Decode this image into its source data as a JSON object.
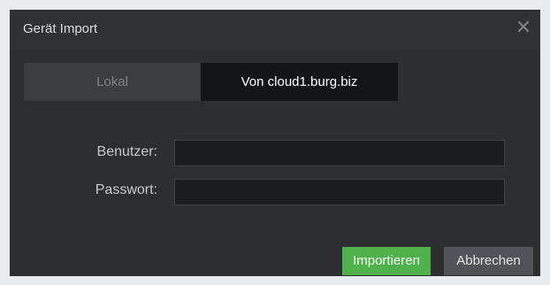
{
  "dialog": {
    "title": "Gerät Import",
    "close_icon": "close-icon"
  },
  "tabs": [
    {
      "label": "Lokal",
      "active": false
    },
    {
      "label": "Von cloud1.burg.biz",
      "active": true
    }
  ],
  "form": {
    "user_label": "Benutzer:",
    "user_value": "",
    "password_label": "Passwort:",
    "password_value": ""
  },
  "buttons": {
    "import_label": "Importieren",
    "cancel_label": "Abbrechen"
  },
  "colors": {
    "dialog_bg": "#2c2e30",
    "active_tab_bg": "#141517",
    "import_green": "#4eb14a",
    "cancel_gray": "#505458"
  }
}
